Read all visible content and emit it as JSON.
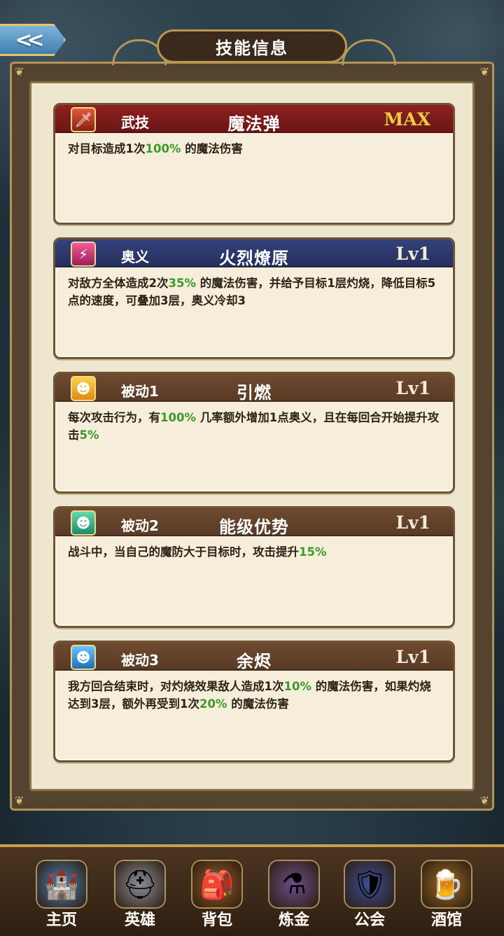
{
  "header": {
    "back_glyph": "<<",
    "title": "技能信息"
  },
  "skills": [
    {
      "type": "武技",
      "name": "魔法弹",
      "level": "MAX",
      "icon": "sword-icon",
      "head_color": "#7c1b1b",
      "desc": [
        {
          "t": "对目标造成1次"
        },
        {
          "t": "100%",
          "hl": true
        },
        {
          "t": " 的魔法伤害"
        }
      ]
    },
    {
      "type": "奥义",
      "name": "火烈燎原",
      "level": "Lv1",
      "icon": "fire-slash-icon",
      "head_color": "#2b3668",
      "desc": [
        {
          "t": "对敌方全体造成2次"
        },
        {
          "t": "35%",
          "hl": true
        },
        {
          "t": " 的魔法伤害，并给予目标1层灼烧，降低目标5点的速度，可叠加3层，奥义冷却3"
        }
      ]
    },
    {
      "type": "被动1",
      "name": "引燃",
      "level": "Lv1",
      "icon": "passive-yellow-icon",
      "head_color": "#613f28",
      "desc": [
        {
          "t": "每次攻击行为，有"
        },
        {
          "t": "100%",
          "hl": true
        },
        {
          "t": " 几率额外增加1点奥义，且在每回合开始提升攻击"
        },
        {
          "t": "5%",
          "hl": true
        }
      ]
    },
    {
      "type": "被动2",
      "name": "能级优势",
      "level": "Lv1",
      "icon": "passive-green-icon",
      "head_color": "#613f28",
      "desc": [
        {
          "t": "战斗中，当自己的魔防大于目标时，攻击提升"
        },
        {
          "t": "15%",
          "hl": true
        }
      ]
    },
    {
      "type": "被动3",
      "name": "余烬",
      "level": "Lv1",
      "icon": "passive-blue-icon",
      "head_color": "#613f28",
      "desc": [
        {
          "t": "我方回合结束时，对灼烧效果敌人造成1次"
        },
        {
          "t": "10%",
          "hl": true
        },
        {
          "t": " 的魔法伤害，如果灼烧达到3层，额外再受到1次"
        },
        {
          "t": "20%",
          "hl": true
        },
        {
          "t": " 的魔法伤害"
        }
      ]
    }
  ],
  "nav": [
    {
      "label": "主页",
      "icon": "castle-icon",
      "glyph": "🏰"
    },
    {
      "label": "英雄",
      "icon": "knight-helmet-icon",
      "glyph": "⛑"
    },
    {
      "label": "背包",
      "icon": "backpack-icon",
      "glyph": "🎒"
    },
    {
      "label": "炼金",
      "icon": "potion-icon",
      "glyph": "⚗"
    },
    {
      "label": "公会",
      "icon": "guild-shield-icon",
      "glyph": "🛡"
    },
    {
      "label": "酒馆",
      "icon": "beer-mug-icon",
      "glyph": "🍺"
    }
  ],
  "colors": {
    "highlight": "#3b9a2a",
    "max_gold": "#f0c94a"
  }
}
